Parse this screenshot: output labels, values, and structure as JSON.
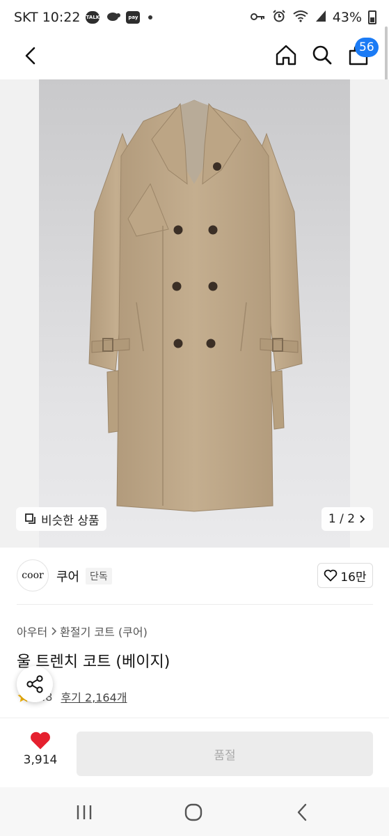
{
  "status_bar": {
    "carrier_time": "SKT 10:22",
    "notif_icons": [
      "kakaotalk-icon",
      "turtle-icon",
      "pay-icon"
    ],
    "talk_label": "TALK",
    "pay_label": "pay",
    "battery": "43%"
  },
  "app_bar": {
    "cart_count": "56"
  },
  "hero": {
    "similar_label": "비슷한 상품",
    "page_counter": "1 / 2"
  },
  "brand": {
    "logo_text": "coor",
    "name": "쿠어",
    "tag": "단독",
    "likes": "16만"
  },
  "product": {
    "breadcrumb": [
      "아우터",
      "환절기 코트 (쿠어)"
    ],
    "title": "울 트렌치 코트 (베이지)",
    "rating": "4.8",
    "reviews": "후기 2,164개"
  },
  "purchase": {
    "wish_count": "3,914",
    "button_label": "품절"
  },
  "colors": {
    "accent_blue": "#1b7bf5",
    "heart_red": "#e5202e",
    "star_yellow": "#f5b50a",
    "coat_beige": "#c0a98a"
  }
}
